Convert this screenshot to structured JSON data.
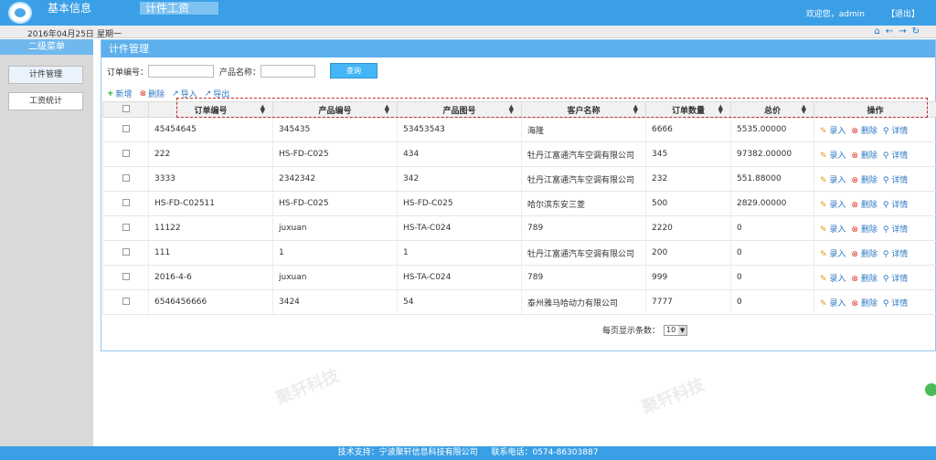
{
  "header": {
    "tabs": [
      "基本信息",
      "计件工资"
    ],
    "welcome": "欢迎您，admin",
    "logout": "【退出】"
  },
  "datebar": {
    "date": "2016年04月25日",
    "weekday": "星期一"
  },
  "sidebar": {
    "title": "二级菜单",
    "items": [
      "计件管理",
      "工资统计"
    ]
  },
  "panel": {
    "title": "计件管理",
    "search": {
      "order_label": "订单编号：",
      "product_label": "产品名称：",
      "order_value": "",
      "product_value": "",
      "button": "查询"
    },
    "toolbar": [
      "新增",
      "删除",
      "导入",
      "导出"
    ],
    "columns": [
      "订单编号",
      "产品编号",
      "产品图号",
      "客户名称",
      "订单数量",
      "总价",
      "操作"
    ],
    "actions": [
      "录入",
      "删除",
      "详情"
    ],
    "rows": [
      [
        "45454645",
        "345435",
        "53453543",
        "海隆",
        "6666",
        "5535.00000"
      ],
      [
        "222",
        "HS-FD-C025",
        "434",
        "牡丹江富通汽车空调有限公司",
        "345",
        "97382.00000"
      ],
      [
        "3333",
        "2342342",
        "342",
        "牡丹江富通汽车空调有限公司",
        "232",
        "551.88000"
      ],
      [
        "HS-FD-C02511",
        "HS-FD-C025",
        "HS-FD-C025",
        "哈尔滨东安三菱",
        "500",
        "2829.00000"
      ],
      [
        "11122",
        "juxuan",
        "HS-TA-C024",
        "789",
        "2220",
        "0"
      ],
      [
        "111",
        "1",
        "1",
        "牡丹江富通汽车空调有限公司",
        "200",
        "0"
      ],
      [
        "2016-4-6",
        "juxuan",
        "HS-TA-C024",
        "789",
        "999",
        "0"
      ],
      [
        "6546456666",
        "3424",
        "54",
        "泰州雅马哈动力有限公司",
        "7777",
        "0"
      ]
    ],
    "pager": {
      "label": "每页显示条数：",
      "value": "10"
    }
  },
  "footer": {
    "support": "技术支持：宁波聚轩信息科技有限公司",
    "phone": "联系电话：0574-86303887"
  },
  "watermark": "聚轩科技",
  "colors": {
    "header_blue": "#3a9fe6",
    "panel_title": "#5db0ec",
    "highlight": "#c0292d"
  }
}
